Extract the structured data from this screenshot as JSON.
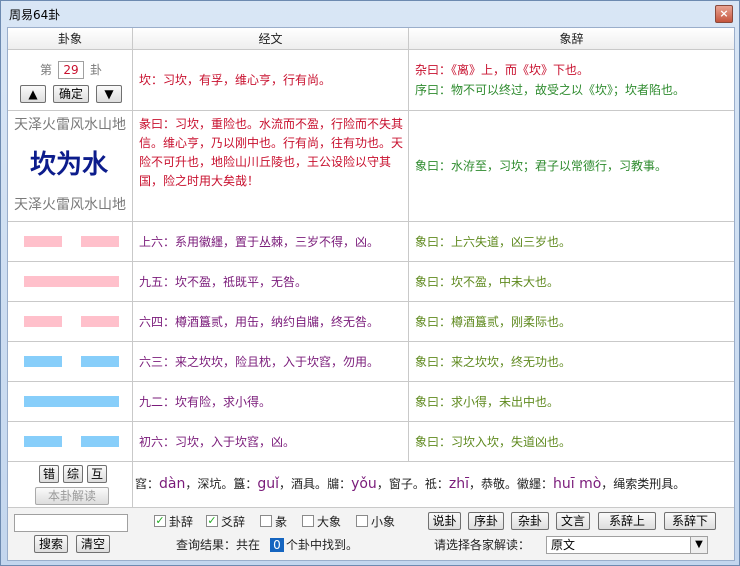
{
  "window": {
    "title": "周易64卦",
    "close_label": "×"
  },
  "headers": {
    "col1": "卦象",
    "col2": "经文",
    "col3": "象辞"
  },
  "nav": {
    "prefix": "第",
    "number": "29",
    "suffix": "卦",
    "confirm_label": "确定",
    "up_glyph": "▲",
    "down_glyph": "▼"
  },
  "top_row": {
    "jing": "坎：习坎，有孚，维心亨，行有尚。",
    "xiang_line1": "杂曰：《离》上，而《坎》下也。",
    "xiang_line2": "序曰：物不可以终过，故受之以《坎》；坎者陷也。"
  },
  "gua": {
    "upper_names": "天泽火雷风水山地",
    "name": "坎为水",
    "lower_names": "天泽火雷风水山地",
    "tuan": "彖曰：习坎，重险也。水流而不盈，行险而不失其信。维心亨，乃以刚中也。行有尚，往有功也。天险不可升也，地险山川丘陵也，王公设险以守其国，险之时用大矣哉！",
    "xiang": "象曰：水洊至，习坎；君子以常德行，习教事。"
  },
  "lines": [
    {
      "yin": true,
      "color": "pink",
      "jing": "上六：系用徽纆，置于丛棘，三岁不得，凶。",
      "xiang": "象曰：上六失道，凶三岁也。"
    },
    {
      "yin": false,
      "color": "pink",
      "jing": "九五：坎不盈，祗既平，无咎。",
      "xiang": "象曰：坎不盈，中未大也。"
    },
    {
      "yin": true,
      "color": "pink",
      "jing": "六四：樽酒簋贰，用缶，纳约自牖，终无咎。",
      "xiang": "象曰：樽酒簋贰，刚柔际也。"
    },
    {
      "yin": true,
      "color": "blue",
      "jing": "六三：来之坎坎，险且枕，入于坎窞，勿用。",
      "xiang": "象曰：来之坎坎，终无功也。"
    },
    {
      "yin": false,
      "color": "blue",
      "jing": "九二：坎有险，求小得。",
      "xiang": "象曰：求小得，未出中也。"
    },
    {
      "yin": true,
      "color": "blue",
      "jing": "初六：习坎，入于坎窞，凶。",
      "xiang": "象曰：习坎入坎，失道凶也。"
    }
  ],
  "side_buttons": {
    "cuo": "错",
    "zong": "综",
    "hu": "互",
    "explain": "本卦解读"
  },
  "notes": [
    {
      "py": "dàn",
      "def": "，深坑。"
    },
    {
      "char": "簋：",
      "py": "guǐ",
      "def": "，酒具。"
    },
    {
      "char": "牖：",
      "py": "yǒu",
      "def": "，窗子。"
    },
    {
      "char": "祗：",
      "py": "zhī",
      "def": "，恭敬。"
    },
    {
      "char": "徽纆：",
      "py": "huī mò",
      "def": "，绳索类刑具。"
    }
  ],
  "notes_lead": "窞：",
  "search": {
    "value": "",
    "search_label": "搜索",
    "clear_label": "清空"
  },
  "checks": [
    {
      "label": "卦辞",
      "checked": true
    },
    {
      "label": "爻辞",
      "checked": true
    },
    {
      "label": "彖",
      "checked": false
    },
    {
      "label": "大象",
      "checked": false
    },
    {
      "label": "小象",
      "checked": false
    }
  ],
  "result": {
    "prefix": "查询结果：共在",
    "count": "0",
    "suffix": "个卦中找到。"
  },
  "right_buttons": [
    "说卦",
    "序卦",
    "杂卦",
    "文言",
    "系辞上",
    "系辞下"
  ],
  "commentary": {
    "label": "请选择各家解读：",
    "selected": "原文"
  },
  "colors": {
    "pink": "#ffc0cb",
    "blue": "#87cefa",
    "number_highlight": "#1565c0"
  }
}
